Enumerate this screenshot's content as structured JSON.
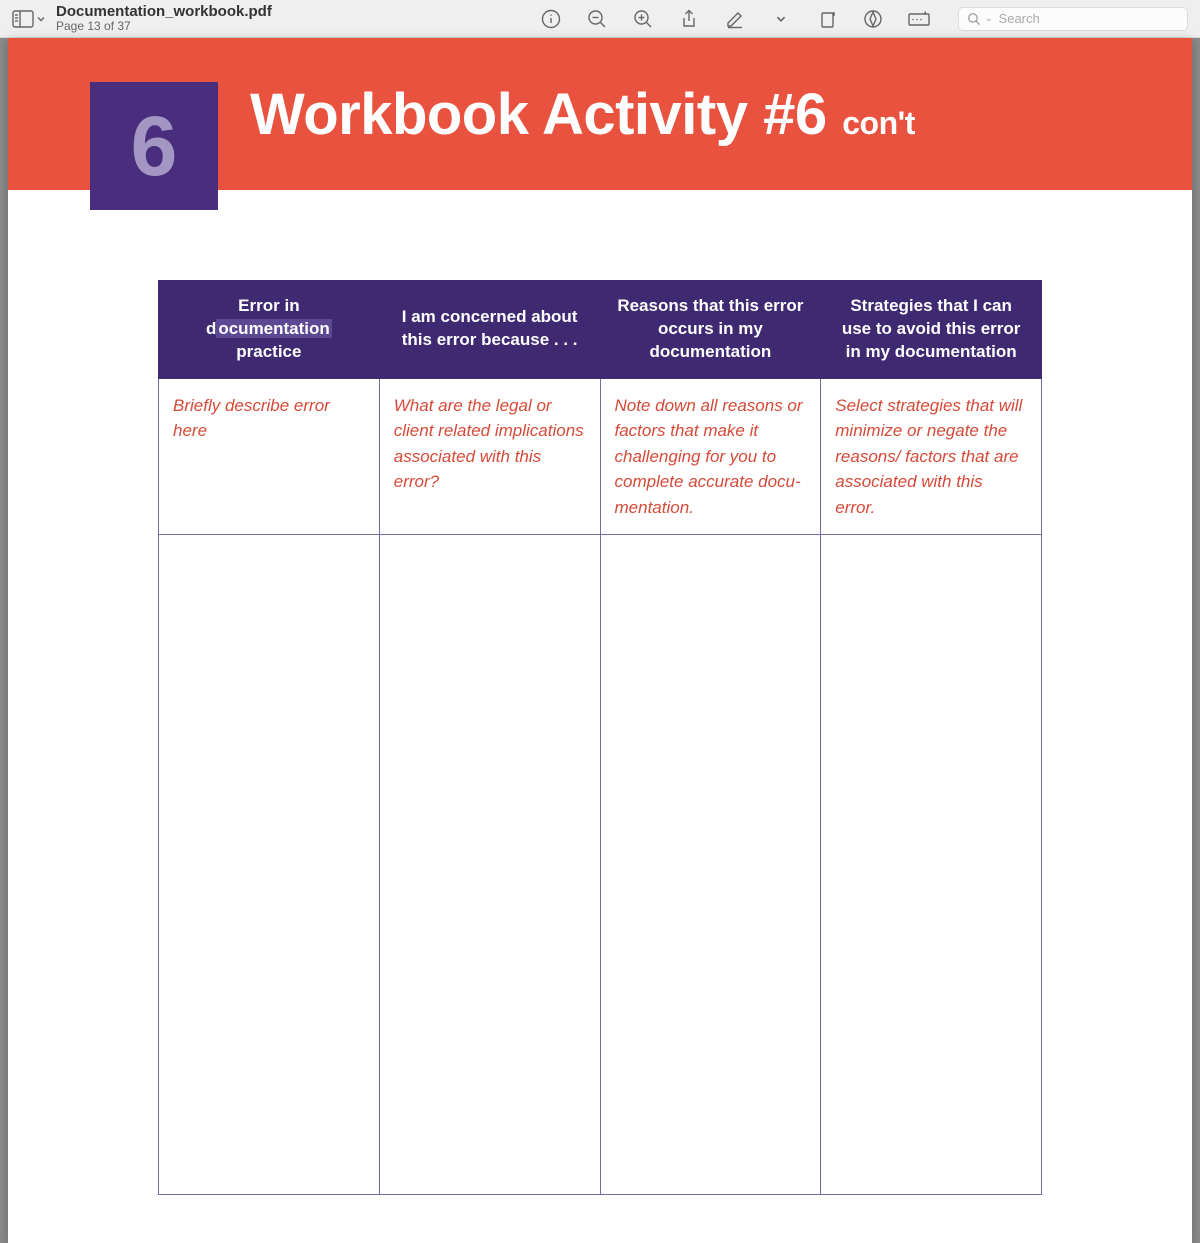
{
  "toolbar": {
    "doc_title": "Documentation_workbook.pdf",
    "page_label": "Page 13 of 37",
    "search_placeholder": "Search"
  },
  "banner": {
    "number": "6",
    "title_main": "Workbook Activity #6",
    "title_suffix": "con't"
  },
  "table": {
    "headers": {
      "col1_pre": "Error in ",
      "col1_hl_pre": "d",
      "col1_hl": "ocumentation",
      "col1_post": " practice",
      "col2": "I am concerned about this error because . . .",
      "col3": "Reasons that this error occurs in my documentation",
      "col4": "Strategies that I can use to avoid this error in my documentation"
    },
    "instructions": {
      "col1": "Briefly describe error here",
      "col2": "What are the legal or client related implica­tions associated with this error?",
      "col3": "Note down all reasons or factors that make it challenging for you to complete accurate docu­mentation.",
      "col4": "Select strategies that will minimize or negate the reasons/ factors that are associated with this error."
    }
  }
}
